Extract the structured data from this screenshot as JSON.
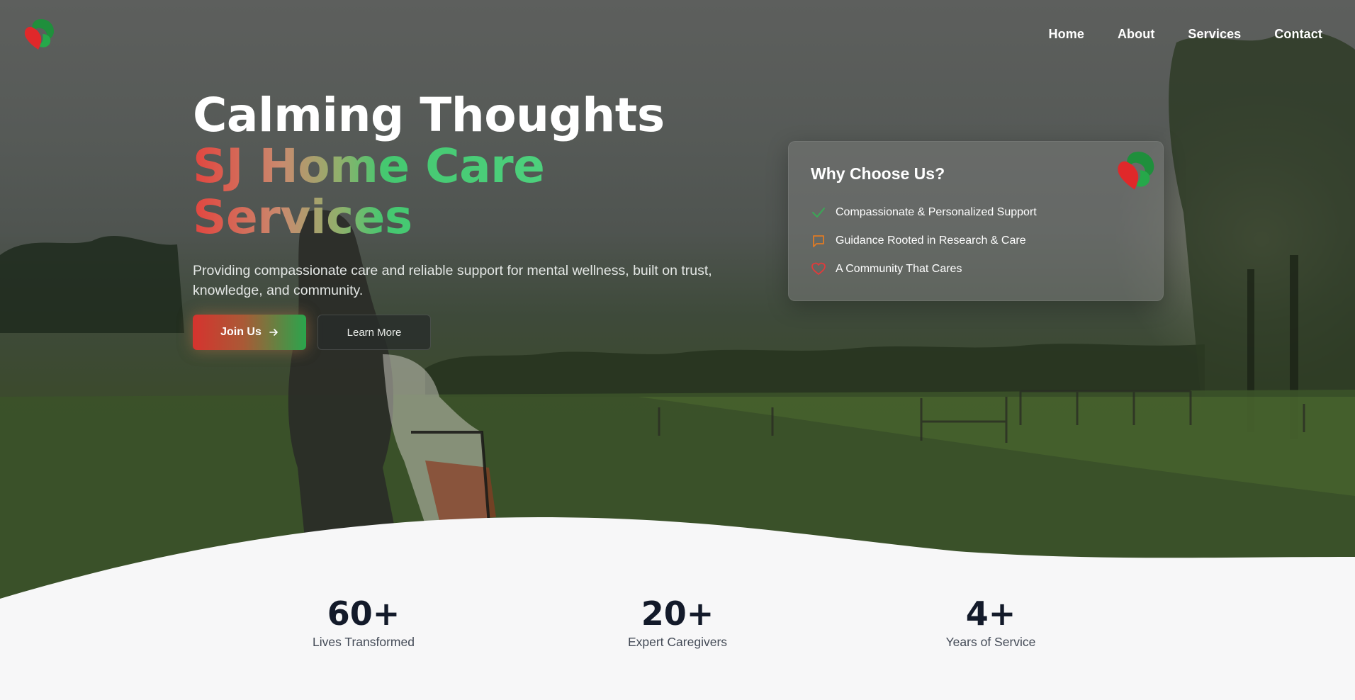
{
  "nav": {
    "items": [
      "Home",
      "About",
      "Services",
      "Contact"
    ]
  },
  "hero": {
    "title_line1": "Calming Thoughts",
    "title_line2": "SJ Home Care",
    "title_line3": "Services",
    "subtitle": "Providing compassionate care and reliable support for mental wellness, built on trust, knowledge, and community.",
    "join_label": "Join Us",
    "learn_label": "Learn More"
  },
  "card": {
    "title": "Why Choose Us?",
    "features": [
      {
        "label": "Compassionate & Personalized Support",
        "icon": "check-icon",
        "color": "#3aa856"
      },
      {
        "label": "Guidance Rooted in Research & Care",
        "icon": "message-square-icon",
        "color": "#e07b24"
      },
      {
        "label": "A Community That Cares",
        "icon": "heart-icon",
        "color": "#e23a3a"
      }
    ]
  },
  "stats": [
    {
      "value": "60+",
      "label": "Lives Transformed"
    },
    {
      "value": "20+",
      "label": "Expert Caregivers"
    },
    {
      "value": "4+",
      "label": "Years of Service"
    }
  ],
  "colors": {
    "brand_red": "#d6332e",
    "brand_green": "#2aa54c",
    "stat_text": "#131a2a"
  }
}
